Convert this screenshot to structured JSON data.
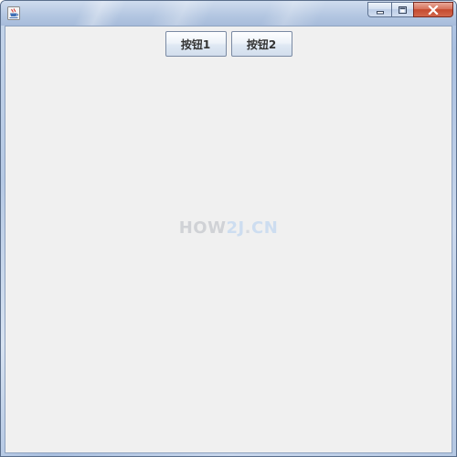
{
  "window": {
    "title": "",
    "icon": "java-cup-icon",
    "caption_buttons": {
      "minimize_icon": "minimize-icon",
      "maximize_icon": "maximize-icon",
      "close_icon": "close-icon"
    }
  },
  "toolbar": {
    "button1_label": "按钮1",
    "button2_label": "按钮2"
  },
  "watermark": {
    "part1": "HOW",
    "part2": "2J",
    "part3": ".",
    "part4": "CN"
  },
  "colors": {
    "client_background": "#f0f0f0",
    "close_button": "#c44a2f",
    "watermark_gray": "#d0d2d6",
    "watermark_blue": "#cdddf0"
  }
}
